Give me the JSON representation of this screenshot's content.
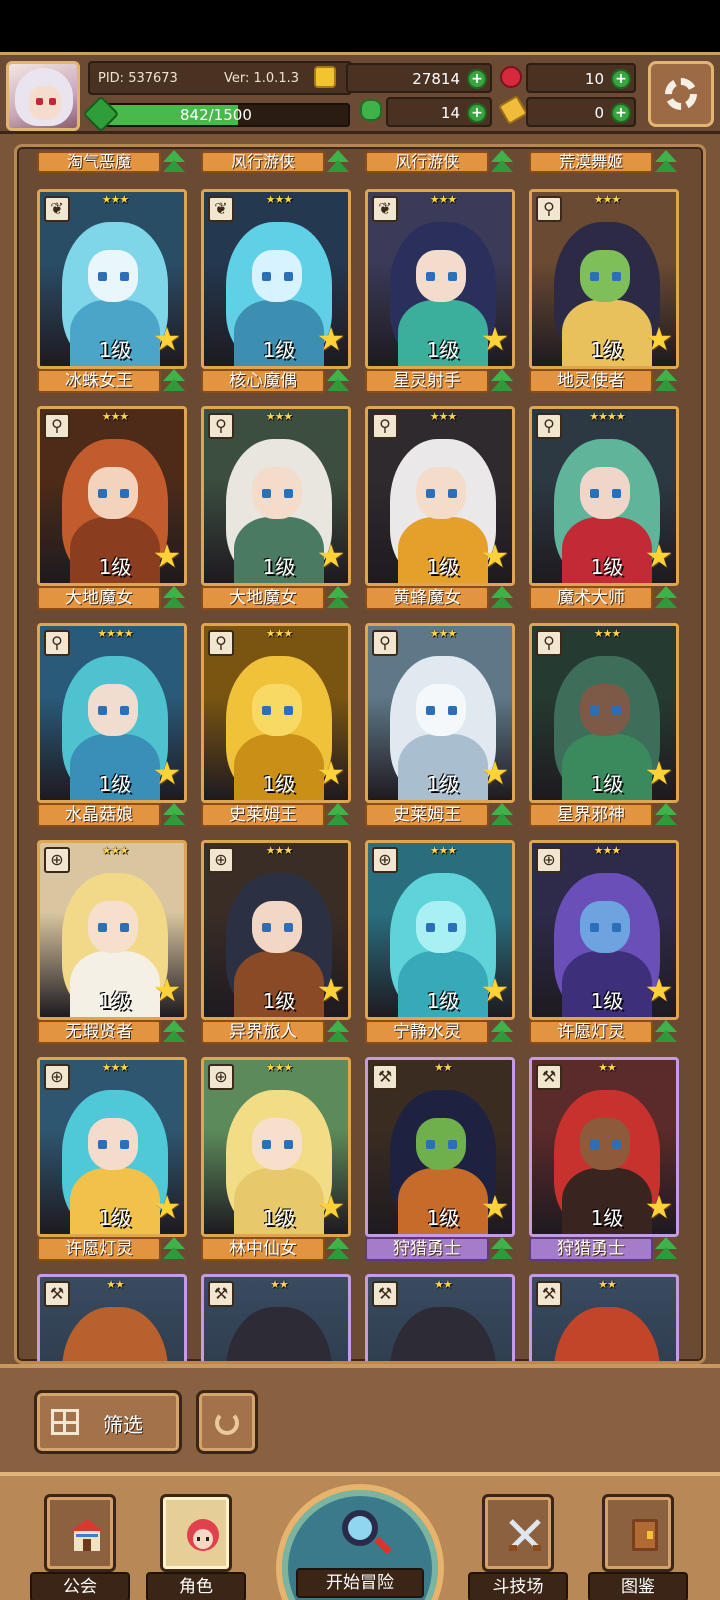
{
  "header": {
    "pid": "PID: 537673",
    "version": "Ver: 1.0.1.3",
    "exp": "842/1500",
    "exp_progress": 0.561,
    "gold": "27814",
    "gems": "10",
    "clover": "14",
    "tickets": "0"
  },
  "top_row_names": [
    "淘气恶魔",
    "风行游侠",
    "风行游侠",
    "荒漠舞姬"
  ],
  "cards": [
    {
      "name": "冰蛛女王",
      "level": "1级",
      "stars": "★★★",
      "type": "leaf",
      "rare": false
    },
    {
      "name": "核心魔偶",
      "level": "1级",
      "stars": "★★★",
      "type": "leaf",
      "rare": false
    },
    {
      "name": "星灵射手",
      "level": "1级",
      "stars": "★★★",
      "type": "leaf",
      "rare": false
    },
    {
      "name": "地灵使者",
      "level": "1级",
      "stars": "★★★",
      "type": "staff",
      "rare": false
    },
    {
      "name": "大地魔女",
      "level": "1级",
      "stars": "★★★",
      "type": "staff",
      "rare": false
    },
    {
      "name": "大地魔女",
      "level": "1级",
      "stars": "★★★",
      "type": "staff",
      "rare": false
    },
    {
      "name": "黄蜂魔女",
      "level": "1级",
      "stars": "★★★",
      "type": "staff",
      "rare": false
    },
    {
      "name": "魔术大师",
      "level": "1级",
      "stars": "★★★★",
      "type": "staff",
      "rare": false
    },
    {
      "name": "水晶菇娘",
      "level": "1级",
      "stars": "★★★★",
      "type": "staff",
      "rare": false
    },
    {
      "name": "史莱姆王",
      "level": "1级",
      "stars": "★★★",
      "type": "staff",
      "rare": false
    },
    {
      "name": "史莱姆王",
      "level": "1级",
      "stars": "★★★",
      "type": "staff",
      "rare": false
    },
    {
      "name": "星界邪神",
      "level": "1级",
      "stars": "★★★",
      "type": "staff",
      "rare": false
    },
    {
      "name": "无瑕贤者",
      "level": "1级",
      "stars": "★★★",
      "type": "shield",
      "rare": false
    },
    {
      "name": "异界旅人",
      "level": "1级",
      "stars": "★★★",
      "type": "shield",
      "rare": false
    },
    {
      "name": "宁静水灵",
      "level": "1级",
      "stars": "★★★",
      "type": "shield",
      "rare": false
    },
    {
      "name": "许愿灯灵",
      "level": "1级",
      "stars": "★★★",
      "type": "shield",
      "rare": false
    },
    {
      "name": "许愿灯灵",
      "level": "1级",
      "stars": "★★★",
      "type": "shield",
      "rare": false
    },
    {
      "name": "林中仙女",
      "level": "1级",
      "stars": "★★★",
      "type": "shield",
      "rare": false
    },
    {
      "name": "狩猎勇士",
      "level": "1级",
      "stars": "★★",
      "type": "axe",
      "rare": true
    },
    {
      "name": "狩猎勇士",
      "level": "1级",
      "stars": "★★",
      "type": "axe",
      "rare": true
    }
  ],
  "partial_row_stars": [
    "★★",
    "★★",
    "★★",
    "★★"
  ],
  "controls": {
    "filter_label": "筛选"
  },
  "nav": {
    "guild": "公会",
    "character": "角色",
    "adventure": "开始冒险",
    "arena": "斗技场",
    "codex": "图鉴"
  },
  "colors": {
    "brown_bg": "#6a4a33",
    "orange_banner": "#e29440",
    "purple_banner": "#a57cc9",
    "upgrade_green": "#3fb24a",
    "star_gold": "#ffd23a"
  }
}
